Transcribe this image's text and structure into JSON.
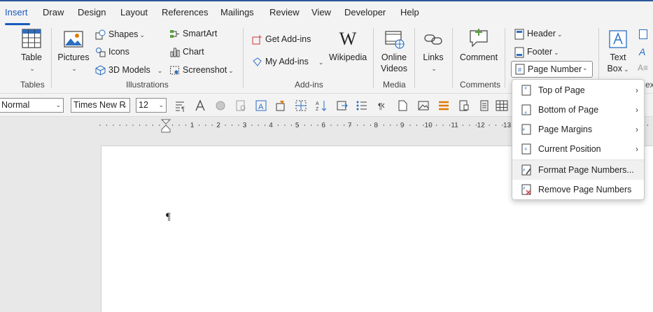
{
  "tabs": [
    {
      "label": "Insert"
    },
    {
      "label": "Draw"
    },
    {
      "label": "Design"
    },
    {
      "label": "Layout"
    },
    {
      "label": "References"
    },
    {
      "label": "Mailings"
    },
    {
      "label": "Review"
    },
    {
      "label": "View"
    },
    {
      "label": "Developer"
    },
    {
      "label": "Help"
    }
  ],
  "ribbon": {
    "tables": {
      "table": "Table",
      "group": "Tables"
    },
    "illustrations": {
      "pictures": "Pictures",
      "shapes": "Shapes",
      "icons": "Icons",
      "models": "3D Models",
      "smartart": "SmartArt",
      "chart": "Chart",
      "screenshot": "Screenshot",
      "group": "Illustrations"
    },
    "addins": {
      "get": "Get Add-ins",
      "my": "My Add-ins",
      "wikipedia": "Wikipedia",
      "group": "Add-ins"
    },
    "media": {
      "online": "Online",
      "videos": "Videos",
      "group": "Media"
    },
    "links": {
      "label": "Links"
    },
    "comments": {
      "comment": "Comment",
      "group": "Comments"
    },
    "header_footer": {
      "header": "Header",
      "footer": "Footer",
      "page_number": "Page Number"
    },
    "text": {
      "text": "Text",
      "box": "Box"
    },
    "cut_text": "ex"
  },
  "format_bar": {
    "style": "Normal",
    "font": "Times New R",
    "size": "12"
  },
  "ruler": {
    "numbers": [
      "1",
      "2",
      "3",
      "4",
      "5",
      "6",
      "7",
      "8",
      "9",
      "10",
      "11",
      "12",
      "13"
    ]
  },
  "document": {
    "pilcrow": "¶"
  },
  "page_number_menu": {
    "items": [
      {
        "label": "Top of Page"
      },
      {
        "label": "Bottom of Page"
      },
      {
        "label": "Page Margins"
      },
      {
        "label": "Current Position"
      },
      {
        "label": "Format Page Numbers..."
      },
      {
        "label": "Remove Page Numbers"
      }
    ]
  },
  "colors": {
    "accent": "#185abd",
    "ribbon": "#f3f3f3",
    "workspace": "#e8e8e8",
    "icon_blue": "#2b6ec2",
    "icon_orange": "#e07b00"
  }
}
